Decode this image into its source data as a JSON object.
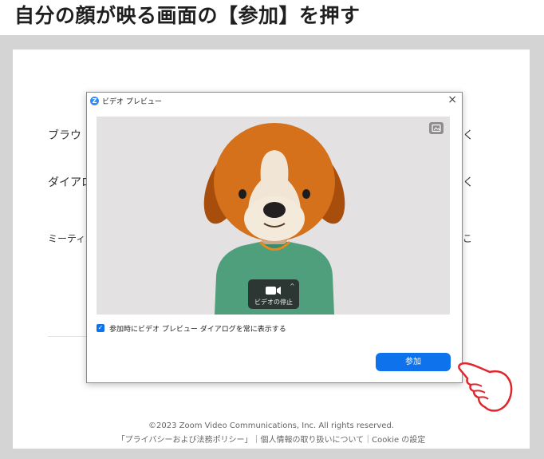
{
  "heading": "自分の顔が映る画面の【参加】を押す",
  "background_page": {
    "rows": [
      "ブラウ",
      "ダイアロ",
      "ミーティ"
    ],
    "right_fragments": [
      "く",
      "く",
      "こ"
    ],
    "footer_copyright": "©2023 Zoom Video Communications, Inc. All rights reserved.",
    "footer_links": "「プライバシーおよび法務ポリシー」｜個人情報の取り扱いについて｜Cookie の設定"
  },
  "dialog": {
    "title": "ビデオ プレビュー",
    "close_glyph": "×",
    "video_control_label": "ビデオの停止",
    "caret": "^",
    "checkbox_checked": true,
    "checkbox_label": "参加時にビデオ プレビュー ダイアログを常に表示する",
    "join_button": "参加"
  },
  "colors": {
    "accent": "#0e72ed",
    "pointer_hand": "#e0262d"
  }
}
